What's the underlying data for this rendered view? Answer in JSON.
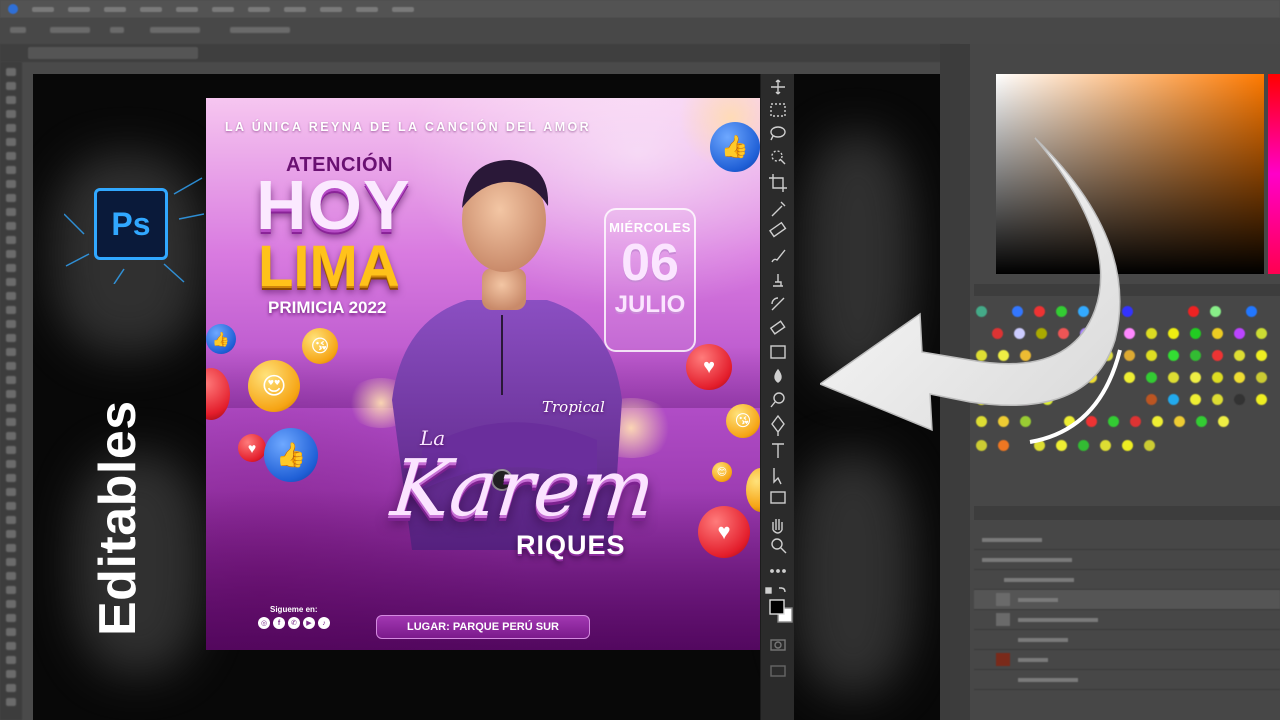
{
  "app": {
    "name": "Adobe Photoshop",
    "logo_label": "Ps",
    "promo_label": "Editables"
  },
  "poster": {
    "tagline": "LA ÚNICA REYNA DE LA CANCIÓN DEL AMOR",
    "headline_top": "ATENCIÓN",
    "headline_main": "HOY",
    "headline_city": "LIMA",
    "subheadline": "PRIMICIA 2022",
    "date": {
      "weekday": "MIÉRCOLES",
      "day": "06",
      "month": "JULIO"
    },
    "script_small": "Tropical",
    "script_prefix": "La",
    "artist_first": "Karem",
    "artist_last": "RIQUES",
    "social_label": "Sigueme en:",
    "social_icons": [
      "instagram-icon",
      "facebook-icon",
      "whatsapp-icon",
      "youtube-icon",
      "tiktok-icon"
    ],
    "venue": "LUGAR: PARQUE PERÚ SUR"
  },
  "tools": [
    "move-tool-icon",
    "marquee-tool-icon",
    "lasso-tool-icon",
    "quick-select-tool-icon",
    "crop-tool-icon",
    "eyedropper-tool-icon",
    "healing-brush-tool-icon",
    "brush-tool-icon",
    "clone-stamp-tool-icon",
    "history-brush-tool-icon",
    "eraser-tool-icon",
    "gradient-tool-icon",
    "blur-tool-icon",
    "dodge-tool-icon",
    "pen-tool-icon",
    "type-tool-icon",
    "path-select-tool-icon",
    "rectangle-tool-icon",
    "hand-tool-icon",
    "zoom-tool-icon",
    "more-tools-icon"
  ],
  "colors": {
    "accent_blue": "#31a8ff",
    "foreground": "#000000",
    "background": "#ffffff",
    "picker_hue": "#ff7a00"
  }
}
